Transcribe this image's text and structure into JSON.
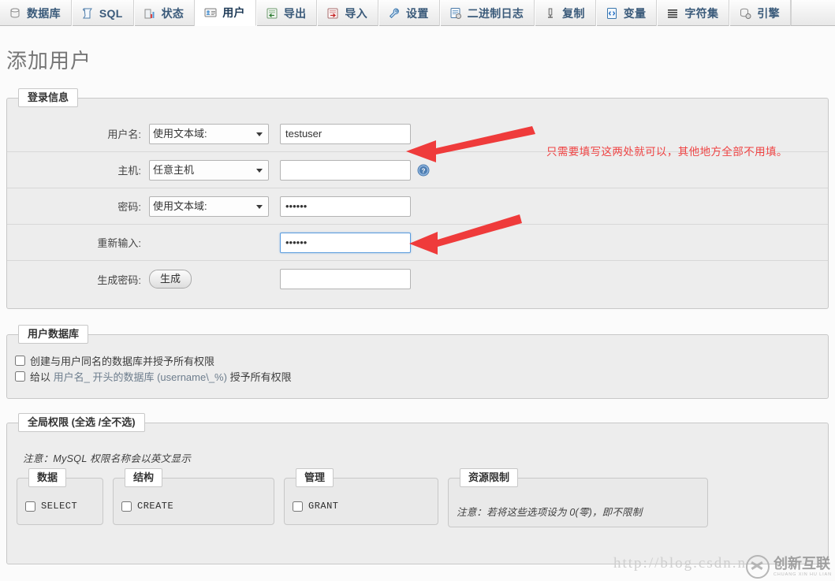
{
  "tabs": [
    {
      "label": "数据库",
      "icon": "database-icon",
      "active": false
    },
    {
      "label": "SQL",
      "icon": "sql-scroll-icon",
      "active": false
    },
    {
      "label": "状态",
      "icon": "status-chart-icon",
      "active": false
    },
    {
      "label": "用户",
      "icon": "users-card-icon",
      "active": true
    },
    {
      "label": "导出",
      "icon": "export-icon",
      "active": false
    },
    {
      "label": "导入",
      "icon": "import-icon",
      "active": false
    },
    {
      "label": "设置",
      "icon": "wrench-icon",
      "active": false
    },
    {
      "label": "二进制日志",
      "icon": "binlog-icon",
      "active": false
    },
    {
      "label": "复制",
      "icon": "replication-icon",
      "active": false
    },
    {
      "label": "变量",
      "icon": "variables-icon",
      "active": false
    },
    {
      "label": "字符集",
      "icon": "charset-icon",
      "active": false
    },
    {
      "label": "引擎",
      "icon": "engine-icon",
      "active": false
    }
  ],
  "page": {
    "title": "添加用户"
  },
  "login_info": {
    "legend": "登录信息",
    "rows": [
      {
        "label": "用户名:",
        "select_value": "使用文本域:",
        "input_value": "testuser",
        "has_help": false,
        "focused": false
      },
      {
        "label": "主机:",
        "select_value": "任意主机",
        "input_value": "",
        "has_help": true,
        "focused": false
      },
      {
        "label": "密码:",
        "select_value": "使用文本域:",
        "input_value": "••••••",
        "has_help": false,
        "focused": false
      },
      {
        "label": "重新输入:",
        "select_value": null,
        "input_value": "••••••",
        "has_help": false,
        "focused": true
      }
    ],
    "generate_row": {
      "label": "生成密码:",
      "button_label": "生成",
      "input_value": ""
    }
  },
  "annotation": {
    "text": "只需要填写这两处就可以，其他地方全部不用填。",
    "color": "#ef4343"
  },
  "user_database": {
    "legend": "用户数据库",
    "options": [
      {
        "label": "创建与用户同名的数据库并授予所有权限",
        "checked": false
      },
      {
        "label_pre": "给以 ",
        "label_mid": "用户名_ 开头的数据库 (username\\_%)",
        "label_post": " 授予所有权限",
        "checked": false
      }
    ]
  },
  "global_privileges": {
    "legend_main": "全局权限",
    "legend_sub": "(全选 /全不选)",
    "note": "注意：MySQL 权限名称会以英文显示",
    "groups": [
      {
        "title": "数据",
        "items": [
          {
            "label": "SELECT",
            "checked": false
          }
        ]
      },
      {
        "title": "结构",
        "items": [
          {
            "label": "CREATE",
            "checked": false
          }
        ]
      },
      {
        "title": "管理",
        "items": [
          {
            "label": "GRANT",
            "checked": false
          }
        ]
      },
      {
        "title": "资源限制",
        "items": [],
        "note": "注意：若将这些选项设为 0(零)，即不限制"
      }
    ]
  },
  "watermarks": {
    "url": "http://blog.csdn.n",
    "logo_cn": "创新互联",
    "logo_en": "CHUANG XIN HU LIAN"
  }
}
